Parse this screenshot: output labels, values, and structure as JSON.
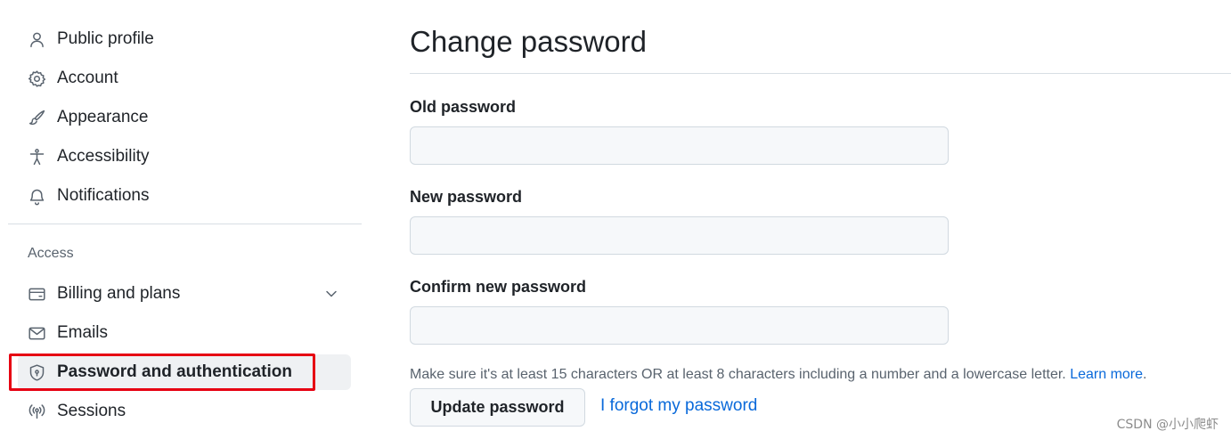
{
  "sidebar": {
    "items": [
      {
        "label": "Public profile",
        "icon": "person-icon"
      },
      {
        "label": "Account",
        "icon": "gear-icon"
      },
      {
        "label": "Appearance",
        "icon": "paintbrush-icon"
      },
      {
        "label": "Accessibility",
        "icon": "accessibility-icon"
      },
      {
        "label": "Notifications",
        "icon": "bell-icon"
      }
    ],
    "access_label": "Access",
    "access_items": [
      {
        "label": "Billing and plans",
        "icon": "credit-card-icon",
        "expandable": true
      },
      {
        "label": "Emails",
        "icon": "mail-icon"
      },
      {
        "label": "Password and authentication",
        "icon": "shield-lock-icon",
        "active": true
      },
      {
        "label": "Sessions",
        "icon": "broadcast-icon"
      }
    ]
  },
  "main": {
    "title": "Change password",
    "fields": [
      {
        "label": "Old password",
        "value": ""
      },
      {
        "label": "New password",
        "value": ""
      },
      {
        "label": "Confirm new password",
        "value": ""
      }
    ],
    "hint_text": "Make sure it's at least 15 characters OR at least 8 characters including a number and a lowercase letter.",
    "hint_link": "Learn more",
    "hint_suffix": ".",
    "update_button": "Update password",
    "forgot_link": "I forgot my password"
  },
  "watermark": "CSDN @小小爬虾",
  "colors": {
    "link": "#0969da",
    "active_bg": "#eff1f3",
    "highlight_border": "#e60012",
    "input_bg": "#f6f8fa"
  }
}
